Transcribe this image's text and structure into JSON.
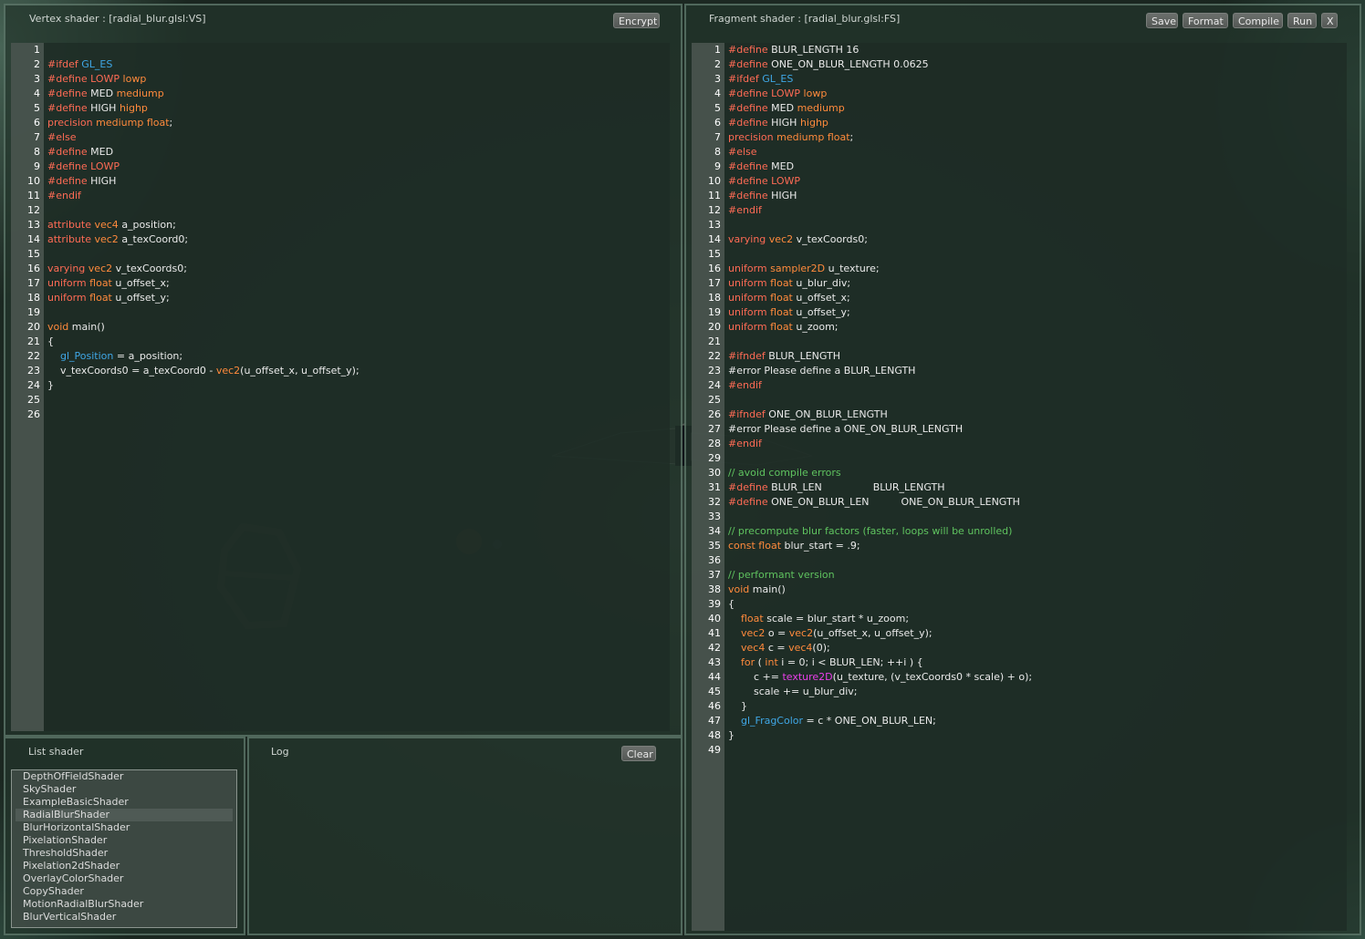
{
  "vertex": {
    "title": "Vertex shader : [radial_blur.glsl:VS]",
    "encrypt_label": "Encrypt",
    "lines": [
      [],
      [
        [
          "k",
          "#ifdef "
        ],
        [
          "b",
          "GL_ES"
        ]
      ],
      [
        [
          "k",
          "#define "
        ],
        [
          "k",
          "LOWP "
        ],
        [
          "t",
          "lowp"
        ]
      ],
      [
        [
          "k",
          "#define "
        ],
        [
          "",
          "MED "
        ],
        [
          "t",
          "mediump"
        ]
      ],
      [
        [
          "k",
          "#define "
        ],
        [
          "",
          "HIGH "
        ],
        [
          "t",
          "highp"
        ]
      ],
      [
        [
          "k",
          "precision "
        ],
        [
          "t",
          "mediump "
        ],
        [
          "t",
          "float"
        ],
        [
          "",
          ";"
        ]
      ],
      [
        [
          "k",
          "#else"
        ]
      ],
      [
        [
          "k",
          "#define "
        ],
        [
          "",
          "MED"
        ]
      ],
      [
        [
          "k",
          "#define "
        ],
        [
          "k",
          "LOWP"
        ]
      ],
      [
        [
          "k",
          "#define "
        ],
        [
          "",
          "HIGH"
        ]
      ],
      [
        [
          "k",
          "#endif"
        ]
      ],
      [],
      [
        [
          "k",
          "attribute "
        ],
        [
          "t",
          "vec4 "
        ],
        [
          "",
          "a_position;"
        ]
      ],
      [
        [
          "k",
          "attribute "
        ],
        [
          "t",
          "vec2 "
        ],
        [
          "",
          "a_texCoord0;"
        ]
      ],
      [],
      [
        [
          "k",
          "varying "
        ],
        [
          "t",
          "vec2 "
        ],
        [
          "",
          "v_texCoords0;"
        ]
      ],
      [
        [
          "k",
          "uniform "
        ],
        [
          "t",
          "float "
        ],
        [
          "",
          "u_offset_x;"
        ]
      ],
      [
        [
          "k",
          "uniform "
        ],
        [
          "t",
          "float "
        ],
        [
          "",
          "u_offset_y;"
        ]
      ],
      [],
      [
        [
          "t",
          "void "
        ],
        [
          "",
          "main()"
        ]
      ],
      [
        [
          "",
          "{"
        ]
      ],
      [
        [
          "",
          "    "
        ],
        [
          "b",
          "gl_Position"
        ],
        [
          "",
          " = a_position;"
        ]
      ],
      [
        [
          "",
          "    v_texCoords0 = a_texCoord0 - "
        ],
        [
          "t",
          "vec2"
        ],
        [
          "",
          "(u_offset_x, u_offset_y);"
        ]
      ],
      [
        [
          "",
          "}"
        ]
      ],
      [],
      []
    ]
  },
  "fragment": {
    "title": "Fragment shader : [radial_blur.glsl:FS]",
    "buttons": [
      "Save",
      "Format",
      "Compile",
      "Run",
      "X"
    ],
    "lines": [
      [
        [
          "k",
          "#define "
        ],
        [
          "",
          "BLUR_LENGTH 16"
        ]
      ],
      [
        [
          "k",
          "#define "
        ],
        [
          "",
          "ONE_ON_BLUR_LENGTH 0.0625"
        ]
      ],
      [
        [
          "k",
          "#ifdef "
        ],
        [
          "b",
          "GL_ES"
        ]
      ],
      [
        [
          "k",
          "#define "
        ],
        [
          "k",
          "LOWP "
        ],
        [
          "t",
          "lowp"
        ]
      ],
      [
        [
          "k",
          "#define "
        ],
        [
          "",
          "MED "
        ],
        [
          "t",
          "mediump"
        ]
      ],
      [
        [
          "k",
          "#define "
        ],
        [
          "",
          "HIGH "
        ],
        [
          "t",
          "highp"
        ]
      ],
      [
        [
          "k",
          "precision "
        ],
        [
          "t",
          "mediump "
        ],
        [
          "t",
          "float"
        ],
        [
          "",
          ";"
        ]
      ],
      [
        [
          "k",
          "#else"
        ]
      ],
      [
        [
          "k",
          "#define "
        ],
        [
          "",
          "MED"
        ]
      ],
      [
        [
          "k",
          "#define "
        ],
        [
          "k",
          "LOWP"
        ]
      ],
      [
        [
          "k",
          "#define "
        ],
        [
          "",
          "HIGH"
        ]
      ],
      [
        [
          "k",
          "#endif"
        ]
      ],
      [],
      [
        [
          "k",
          "varying "
        ],
        [
          "t",
          "vec2 "
        ],
        [
          "",
          "v_texCoords0;"
        ]
      ],
      [],
      [
        [
          "k",
          "uniform "
        ],
        [
          "t",
          "sampler2D "
        ],
        [
          "",
          "u_texture;"
        ]
      ],
      [
        [
          "k",
          "uniform "
        ],
        [
          "t",
          "float "
        ],
        [
          "",
          "u_blur_div;"
        ]
      ],
      [
        [
          "k",
          "uniform "
        ],
        [
          "t",
          "float "
        ],
        [
          "",
          "u_offset_x;"
        ]
      ],
      [
        [
          "k",
          "uniform "
        ],
        [
          "t",
          "float "
        ],
        [
          "",
          "u_offset_y;"
        ]
      ],
      [
        [
          "k",
          "uniform "
        ],
        [
          "t",
          "float "
        ],
        [
          "",
          "u_zoom;"
        ]
      ],
      [],
      [
        [
          "k",
          "#ifndef "
        ],
        [
          "",
          "BLUR_LENGTH"
        ]
      ],
      [
        [
          "",
          "#error Please define a BLUR_LENGTH"
        ]
      ],
      [
        [
          "k",
          "#endif"
        ]
      ],
      [],
      [
        [
          "k",
          "#ifndef "
        ],
        [
          "",
          "ONE_ON_BLUR_LENGTH"
        ]
      ],
      [
        [
          "",
          "#error Please define a ONE_ON_BLUR_LENGTH"
        ]
      ],
      [
        [
          "k",
          "#endif"
        ]
      ],
      [],
      [
        [
          "c",
          "// avoid compile errors"
        ]
      ],
      [
        [
          "k",
          "#define "
        ],
        [
          "",
          "BLUR_LEN                BLUR_LENGTH"
        ]
      ],
      [
        [
          "k",
          "#define "
        ],
        [
          "",
          "ONE_ON_BLUR_LEN          ONE_ON_BLUR_LENGTH"
        ]
      ],
      [],
      [
        [
          "c",
          "// precompute blur factors (faster, loops will be unrolled)"
        ]
      ],
      [
        [
          "t",
          "const "
        ],
        [
          "t",
          "float "
        ],
        [
          "",
          "blur_start = .9;"
        ]
      ],
      [],
      [
        [
          "c",
          "// performant version"
        ]
      ],
      [
        [
          "t",
          "void "
        ],
        [
          "",
          "main()"
        ]
      ],
      [
        [
          "",
          "{"
        ]
      ],
      [
        [
          "",
          "    "
        ],
        [
          "t",
          "float "
        ],
        [
          "",
          "scale = blur_start * u_zoom;"
        ]
      ],
      [
        [
          "",
          "    "
        ],
        [
          "t",
          "vec2 "
        ],
        [
          "",
          "o = "
        ],
        [
          "t",
          "vec2"
        ],
        [
          "",
          "(u_offset_x, u_offset_y);"
        ]
      ],
      [
        [
          "",
          "    "
        ],
        [
          "t",
          "vec4 "
        ],
        [
          "",
          "c = "
        ],
        [
          "t",
          "vec4"
        ],
        [
          "",
          "(0);"
        ]
      ],
      [
        [
          "",
          "    "
        ],
        [
          "t",
          "for "
        ],
        [
          "",
          "( "
        ],
        [
          "t",
          "int "
        ],
        [
          "",
          "i = 0; i < BLUR_LEN; ++i ) {"
        ]
      ],
      [
        [
          "",
          "        c += "
        ],
        [
          "m",
          "texture2D"
        ],
        [
          "",
          "(u_texture, (v_texCoords0 * scale) + o);"
        ]
      ],
      [
        [
          "",
          "        scale += u_blur_div;"
        ]
      ],
      [
        [
          "",
          "    }"
        ]
      ],
      [
        [
          "",
          "    "
        ],
        [
          "b",
          "gl_FragColor"
        ],
        [
          "",
          " = c * ONE_ON_BLUR_LEN;"
        ]
      ],
      [
        [
          "",
          "}"
        ]
      ],
      []
    ]
  },
  "list": {
    "title": "List shader",
    "items": [
      "DepthOfFieldShader",
      "SkyShader",
      "ExampleBasicShader",
      "RadialBlurShader",
      "BlurHorizontalShader",
      "PixelationShader",
      "ThresholdShader",
      "Pixelation2dShader",
      "OverlayColorShader",
      "CopyShader",
      "MotionRadialBlurShader",
      "BlurVerticalShader"
    ],
    "selected": "RadialBlurShader"
  },
  "log": {
    "title": "Log",
    "clear_label": "Clear"
  }
}
